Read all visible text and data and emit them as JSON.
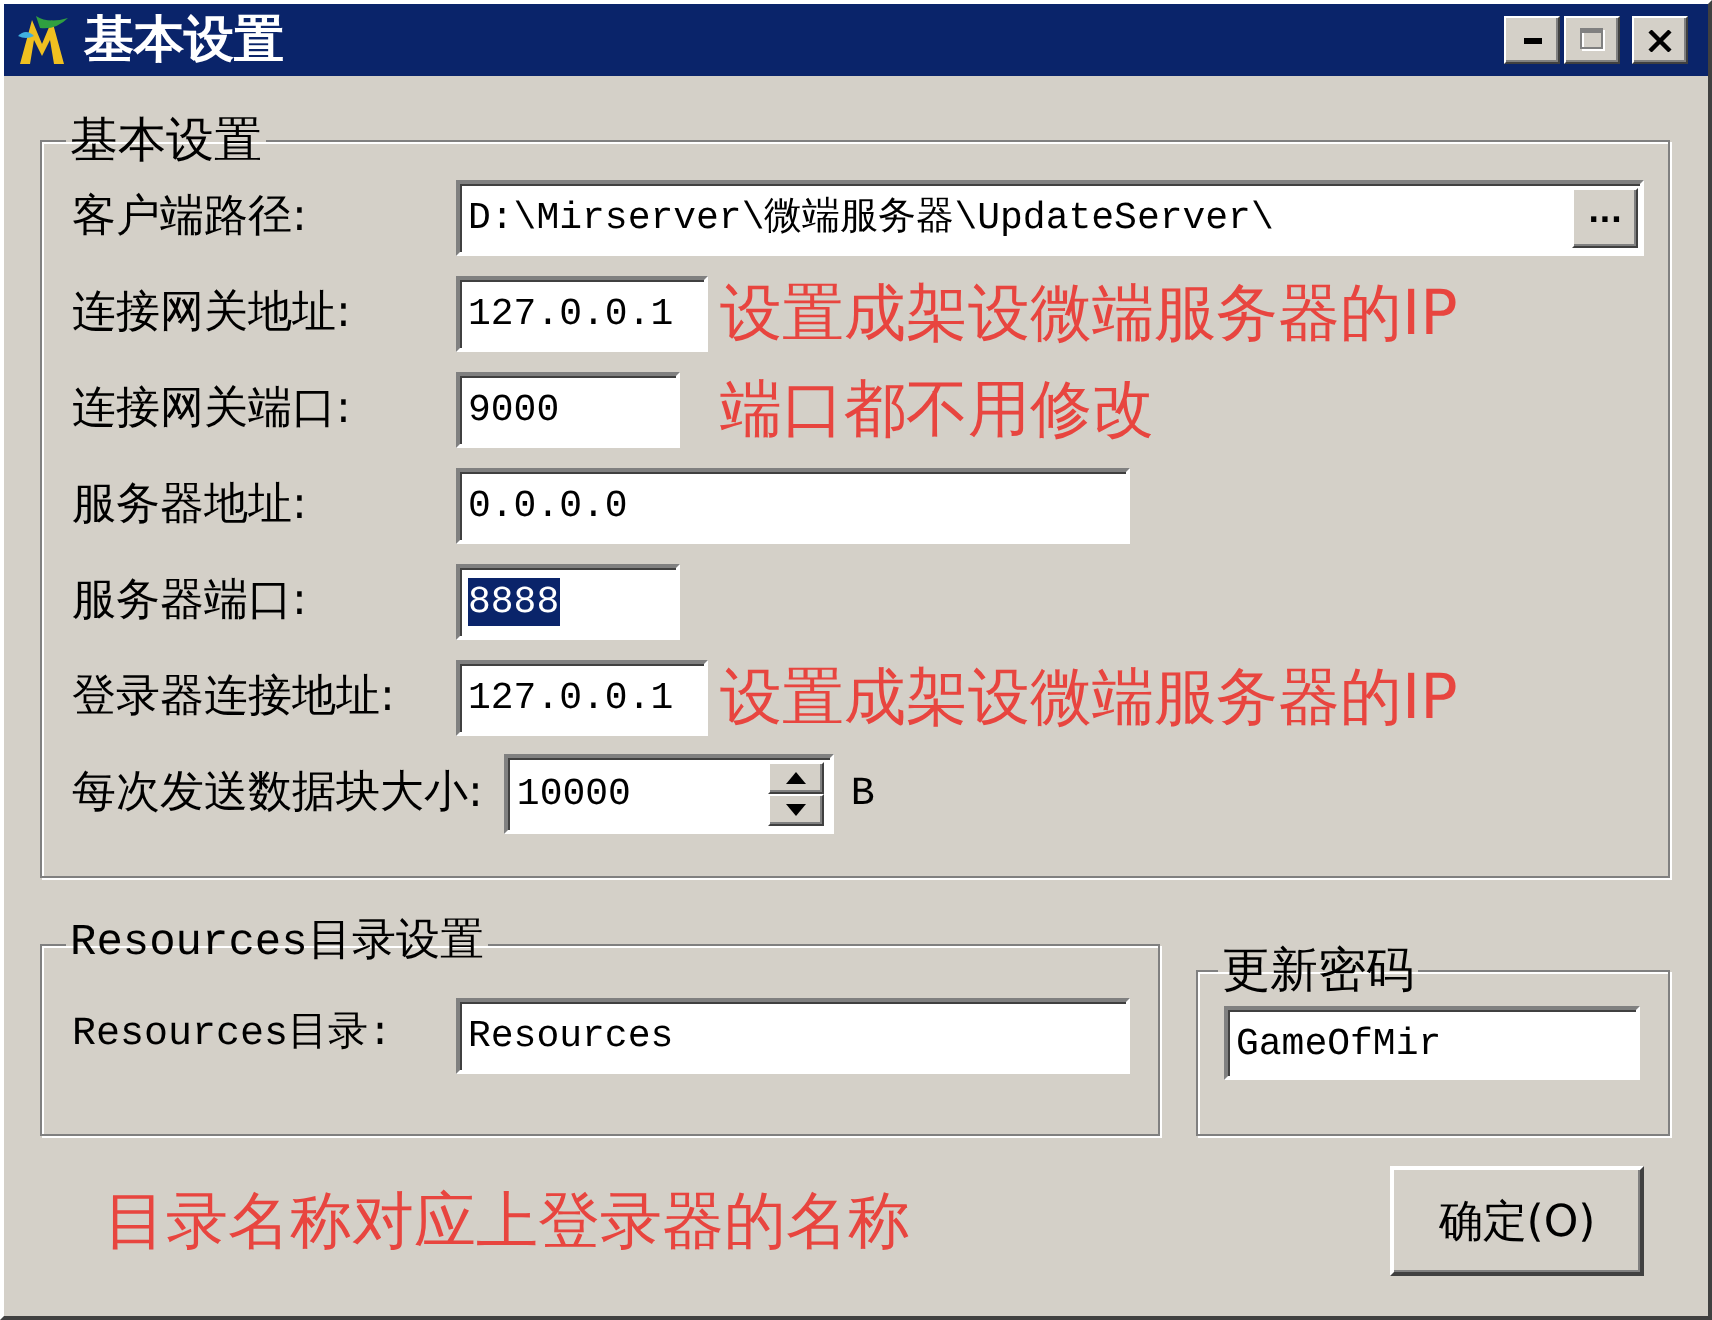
{
  "window": {
    "title": "基本设置",
    "controls": [
      {
        "kind": "minimize",
        "disabled": false
      },
      {
        "kind": "maximize",
        "disabled": true
      },
      {
        "kind": "close",
        "disabled": false
      }
    ]
  },
  "basic_group": {
    "title": "基本设置",
    "rows": [
      {
        "kind": "path",
        "label": "客户端路径:",
        "value": "D:\\Mirserver\\微端服务器\\UpdateServer\\",
        "button": "...",
        "highlighted": false
      },
      {
        "kind": "wide",
        "label": "连接网关地址:",
        "value": "127.0.0.1",
        "annotation": "设置成架设微端服务器的IP",
        "highlighted": false
      },
      {
        "kind": "narrow",
        "label": "连接网关端口:",
        "value": "9000",
        "annotation": "端口都不用修改",
        "highlighted": false
      },
      {
        "kind": "wide",
        "label": "服务器地址:",
        "value": "0.0.0.0",
        "highlighted": false
      },
      {
        "kind": "narrow",
        "label": "服务器端口:",
        "value": "8888",
        "highlighted": true
      },
      {
        "kind": "wide",
        "label": "登录器连接地址:",
        "value": "127.0.0.1",
        "annotation": "设置成架设微端服务器的IP",
        "highlighted": false
      },
      {
        "kind": "spinner",
        "label": "每次发送数据块大小:",
        "value": "10000",
        "unit": "B",
        "highlighted": false
      }
    ]
  },
  "resources_group": {
    "title": "Resources目录设置",
    "label": "Resources目录:",
    "value": "Resources"
  },
  "password_group": {
    "title": "更新密码",
    "value": "GameOfMir"
  },
  "footer_note": "目录名称对应上登录器的名称",
  "ok_button": "确定(O)"
}
